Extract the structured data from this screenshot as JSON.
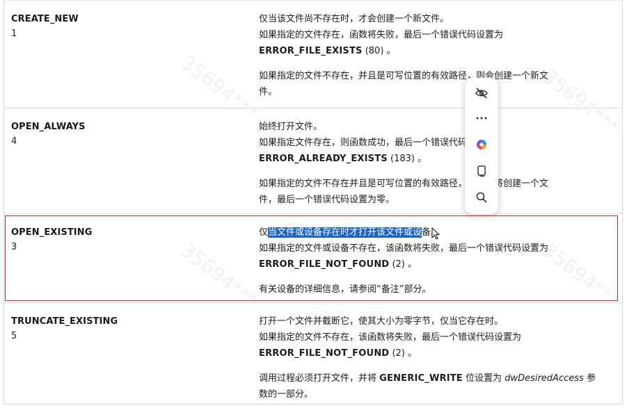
{
  "rows": [
    {
      "name": "CREATE_NEW",
      "value": "1",
      "desc_line1": "仅当该文件尚不存在时，才会创建一个新文件。",
      "desc_line2": "如果指定的文件存在，函数将失败，最后一个错误代码设置为",
      "code": "ERROR_FILE_EXISTS",
      "code_num": "(80) 。",
      "desc_para2_a": "如果指定的文件不存在，并且是可写位置的有效路径，则会创建一个新文",
      "desc_para2_b": "件。"
    },
    {
      "name": "OPEN_ALWAYS",
      "value": "4",
      "desc_line1": "始终打开文件。",
      "desc_line2": "如果指定文件存在，则函数成功，最后一个错误代码设置为",
      "code": "ERROR_ALREADY_EXISTS",
      "code_num": "(183) 。",
      "desc_para2_a": "如果指定的文件不存在并且是可写位置的有效路径，该函数将创建一个文",
      "desc_para2_b": "件，最后一个错误代码设置为零。"
    },
    {
      "name": "OPEN_EXISTING",
      "value": "3",
      "desc_line1_pre": "仅",
      "desc_line1_sel": "当文件或设备存在时才打开该文件或设",
      "desc_line1_post": "备。",
      "desc_line2": "如果指定的文件或设备不存在，该函数将失败，最后一个错误代码设置为",
      "code": "ERROR_FILE_NOT_FOUND",
      "code_num": "(2) 。",
      "desc_para2_a": "有关设备的详细信息，请参阅“备注”部分。"
    },
    {
      "name": "TRUNCATE_EXISTING",
      "value": "5",
      "desc_line1": "打开一个文件并截断它，使其大小为零字节，仅当它存在时。",
      "desc_line2": "如果指定的文件不存在，该函数将失败，最后一个错误代码设置为",
      "code": "ERROR_FILE_NOT_FOUND",
      "code_num": "(2) 。",
      "desc_para2_pre": "调用过程必须打开文件，并将",
      "desc_para2_code": "GENERIC_WRITE",
      "desc_para2_mid": "位设置为",
      "desc_para2_em": "dwDesiredAccess",
      "desc_para2_post": "参",
      "desc_para2_b": "数的一部分。"
    }
  ],
  "mini_menu": {
    "items": [
      "eye-slash-icon",
      "more-options-icon",
      "copilot-icon",
      "copy-icon",
      "search-icon"
    ]
  },
  "colors": {
    "highlight_border": "#d01e2a",
    "selection": "#1a64c8"
  }
}
